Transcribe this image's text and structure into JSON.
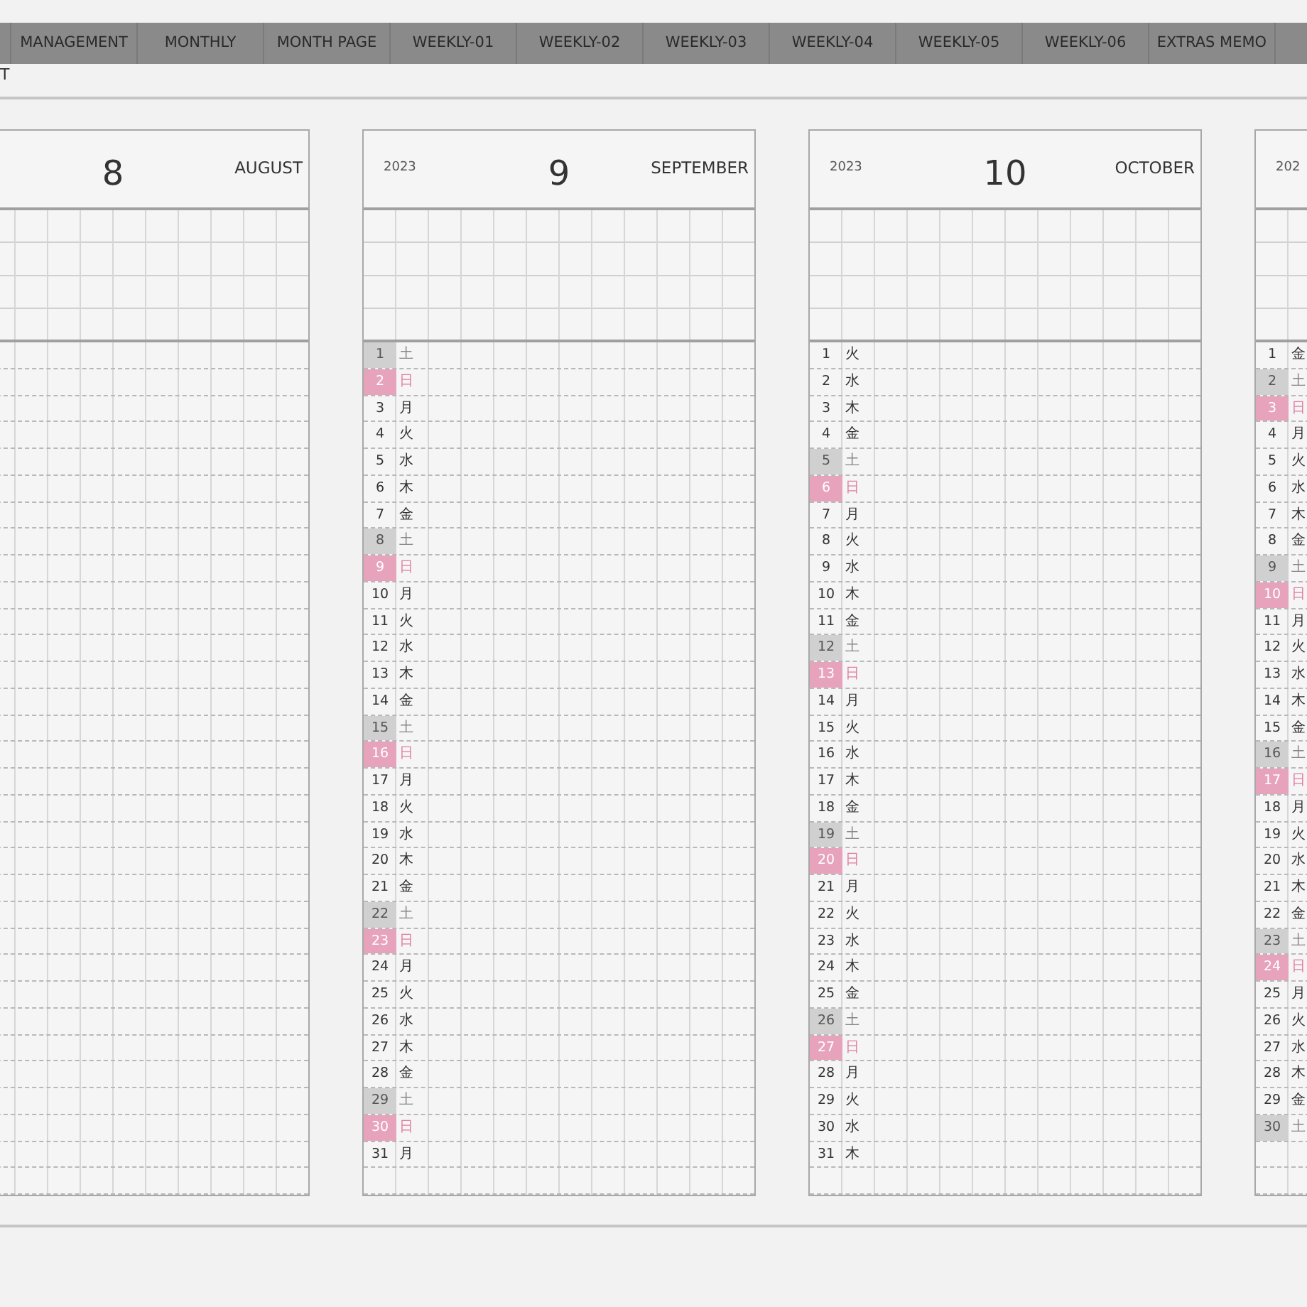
{
  "tabs": [
    {
      "label": "MANAGEMENT"
    },
    {
      "label": "MONTHLY"
    },
    {
      "label": "MONTH PAGE"
    },
    {
      "label": "WEEKLY-01"
    },
    {
      "label": "WEEKLY-02"
    },
    {
      "label": "WEEKLY-03"
    },
    {
      "label": "WEEKLY-04"
    },
    {
      "label": "WEEKLY-05"
    },
    {
      "label": "WEEKLY-06"
    },
    {
      "label": "EXTRAS MEMO"
    }
  ],
  "cut_label": "T",
  "months": [
    {
      "number": "8",
      "name": "AUGUST"
    },
    {
      "year": "2023",
      "number": "9",
      "name": "SEPTEMBER",
      "days": [
        {
          "n": "1",
          "w": "土",
          "kind": "saturday"
        },
        {
          "n": "2",
          "w": "日",
          "kind": "sunday"
        },
        {
          "n": "3",
          "w": "月",
          "kind": "weekday"
        },
        {
          "n": "4",
          "w": "火",
          "kind": "weekday"
        },
        {
          "n": "5",
          "w": "水",
          "kind": "weekday"
        },
        {
          "n": "6",
          "w": "木",
          "kind": "weekday"
        },
        {
          "n": "7",
          "w": "金",
          "kind": "weekday"
        },
        {
          "n": "8",
          "w": "土",
          "kind": "saturday"
        },
        {
          "n": "9",
          "w": "日",
          "kind": "sunday"
        },
        {
          "n": "10",
          "w": "月",
          "kind": "weekday"
        },
        {
          "n": "11",
          "w": "火",
          "kind": "weekday"
        },
        {
          "n": "12",
          "w": "水",
          "kind": "weekday"
        },
        {
          "n": "13",
          "w": "木",
          "kind": "weekday"
        },
        {
          "n": "14",
          "w": "金",
          "kind": "weekday"
        },
        {
          "n": "15",
          "w": "土",
          "kind": "saturday"
        },
        {
          "n": "16",
          "w": "日",
          "kind": "sunday"
        },
        {
          "n": "17",
          "w": "月",
          "kind": "weekday"
        },
        {
          "n": "18",
          "w": "火",
          "kind": "weekday"
        },
        {
          "n": "19",
          "w": "水",
          "kind": "weekday"
        },
        {
          "n": "20",
          "w": "木",
          "kind": "weekday"
        },
        {
          "n": "21",
          "w": "金",
          "kind": "weekday"
        },
        {
          "n": "22",
          "w": "土",
          "kind": "saturday"
        },
        {
          "n": "23",
          "w": "日",
          "kind": "sunday"
        },
        {
          "n": "24",
          "w": "月",
          "kind": "weekday"
        },
        {
          "n": "25",
          "w": "火",
          "kind": "weekday"
        },
        {
          "n": "26",
          "w": "水",
          "kind": "weekday"
        },
        {
          "n": "27",
          "w": "木",
          "kind": "weekday"
        },
        {
          "n": "28",
          "w": "金",
          "kind": "weekday"
        },
        {
          "n": "29",
          "w": "土",
          "kind": "saturday"
        },
        {
          "n": "30",
          "w": "日",
          "kind": "sunday"
        },
        {
          "n": "31",
          "w": "月",
          "kind": "weekday"
        }
      ]
    },
    {
      "year": "2023",
      "number": "10",
      "name": "OCTOBER",
      "days": [
        {
          "n": "1",
          "w": "火",
          "kind": "weekday"
        },
        {
          "n": "2",
          "w": "水",
          "kind": "weekday"
        },
        {
          "n": "3",
          "w": "木",
          "kind": "weekday"
        },
        {
          "n": "4",
          "w": "金",
          "kind": "weekday"
        },
        {
          "n": "5",
          "w": "土",
          "kind": "saturday"
        },
        {
          "n": "6",
          "w": "日",
          "kind": "sunday"
        },
        {
          "n": "7",
          "w": "月",
          "kind": "weekday"
        },
        {
          "n": "8",
          "w": "火",
          "kind": "weekday"
        },
        {
          "n": "9",
          "w": "水",
          "kind": "weekday"
        },
        {
          "n": "10",
          "w": "木",
          "kind": "weekday"
        },
        {
          "n": "11",
          "w": "金",
          "kind": "weekday"
        },
        {
          "n": "12",
          "w": "土",
          "kind": "saturday"
        },
        {
          "n": "13",
          "w": "日",
          "kind": "sunday"
        },
        {
          "n": "14",
          "w": "月",
          "kind": "weekday"
        },
        {
          "n": "15",
          "w": "火",
          "kind": "weekday"
        },
        {
          "n": "16",
          "w": "水",
          "kind": "weekday"
        },
        {
          "n": "17",
          "w": "木",
          "kind": "weekday"
        },
        {
          "n": "18",
          "w": "金",
          "kind": "weekday"
        },
        {
          "n": "19",
          "w": "土",
          "kind": "saturday"
        },
        {
          "n": "20",
          "w": "日",
          "kind": "sunday"
        },
        {
          "n": "21",
          "w": "月",
          "kind": "weekday"
        },
        {
          "n": "22",
          "w": "火",
          "kind": "weekday"
        },
        {
          "n": "23",
          "w": "水",
          "kind": "weekday"
        },
        {
          "n": "24",
          "w": "木",
          "kind": "weekday"
        },
        {
          "n": "25",
          "w": "金",
          "kind": "weekday"
        },
        {
          "n": "26",
          "w": "土",
          "kind": "saturday"
        },
        {
          "n": "27",
          "w": "日",
          "kind": "sunday"
        },
        {
          "n": "28",
          "w": "月",
          "kind": "weekday"
        },
        {
          "n": "29",
          "w": "火",
          "kind": "weekday"
        },
        {
          "n": "30",
          "w": "水",
          "kind": "weekday"
        },
        {
          "n": "31",
          "w": "木",
          "kind": "weekday"
        }
      ]
    },
    {
      "year": "202",
      "days": [
        {
          "n": "1",
          "w": "金",
          "kind": "weekday"
        },
        {
          "n": "2",
          "w": "土",
          "kind": "saturday"
        },
        {
          "n": "3",
          "w": "日",
          "kind": "sunday"
        },
        {
          "n": "4",
          "w": "月",
          "kind": "weekday"
        },
        {
          "n": "5",
          "w": "火",
          "kind": "weekday"
        },
        {
          "n": "6",
          "w": "水",
          "kind": "weekday"
        },
        {
          "n": "7",
          "w": "木",
          "kind": "weekday"
        },
        {
          "n": "8",
          "w": "金",
          "kind": "weekday"
        },
        {
          "n": "9",
          "w": "土",
          "kind": "saturday"
        },
        {
          "n": "10",
          "w": "日",
          "kind": "sunday"
        },
        {
          "n": "11",
          "w": "月",
          "kind": "weekday"
        },
        {
          "n": "12",
          "w": "火",
          "kind": "weekday"
        },
        {
          "n": "13",
          "w": "水",
          "kind": "weekday"
        },
        {
          "n": "14",
          "w": "木",
          "kind": "weekday"
        },
        {
          "n": "15",
          "w": "金",
          "kind": "weekday"
        },
        {
          "n": "16",
          "w": "土",
          "kind": "saturday"
        },
        {
          "n": "17",
          "w": "日",
          "kind": "sunday"
        },
        {
          "n": "18",
          "w": "月",
          "kind": "weekday"
        },
        {
          "n": "19",
          "w": "火",
          "kind": "weekday"
        },
        {
          "n": "20",
          "w": "水",
          "kind": "weekday"
        },
        {
          "n": "21",
          "w": "木",
          "kind": "weekday"
        },
        {
          "n": "22",
          "w": "金",
          "kind": "weekday"
        },
        {
          "n": "23",
          "w": "土",
          "kind": "saturday"
        },
        {
          "n": "24",
          "w": "日",
          "kind": "sunday"
        },
        {
          "n": "25",
          "w": "月",
          "kind": "weekday"
        },
        {
          "n": "26",
          "w": "火",
          "kind": "weekday"
        },
        {
          "n": "27",
          "w": "水",
          "kind": "weekday"
        },
        {
          "n": "28",
          "w": "木",
          "kind": "weekday"
        },
        {
          "n": "29",
          "w": "金",
          "kind": "weekday"
        },
        {
          "n": "30",
          "w": "土",
          "kind": "saturday"
        }
      ]
    }
  ]
}
